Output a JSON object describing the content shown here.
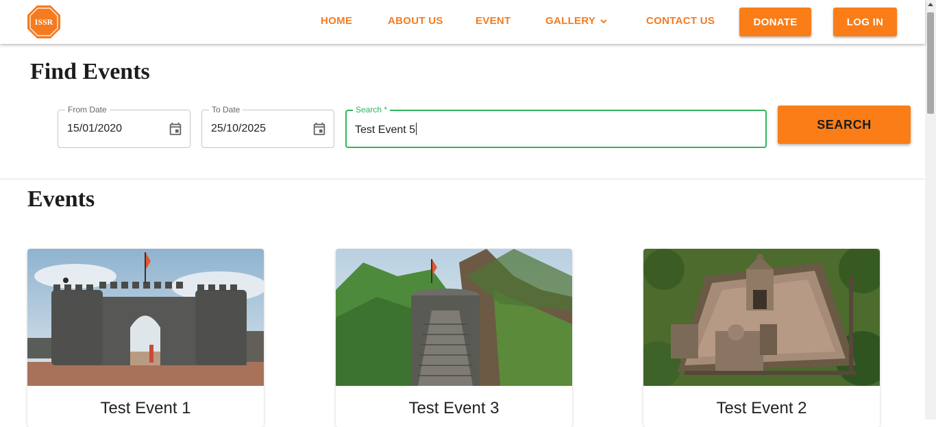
{
  "logo": {
    "text": "ISSR"
  },
  "nav": {
    "home": "HOME",
    "about": "ABOUT US",
    "event": "EVENT",
    "gallery": "GALLERY",
    "contact": "CONTACT US",
    "donate": "DONATE",
    "login": "LOG IN"
  },
  "find": {
    "title": "Find Events",
    "from_label": "From Date",
    "from_value": "15/01/2020",
    "to_label": "To Date",
    "to_value": "25/10/2025",
    "search_label": "Search *",
    "search_value": "Test Event 5",
    "search_button": "SEARCH"
  },
  "events": {
    "title": "Events",
    "cards": [
      {
        "title": "Test Event 1"
      },
      {
        "title": "Test Event 3"
      },
      {
        "title": "Test Event 2"
      }
    ]
  },
  "colors": {
    "accent": "#fb7d17",
    "nav_text": "#f47b20",
    "focus": "#2eb45c"
  }
}
